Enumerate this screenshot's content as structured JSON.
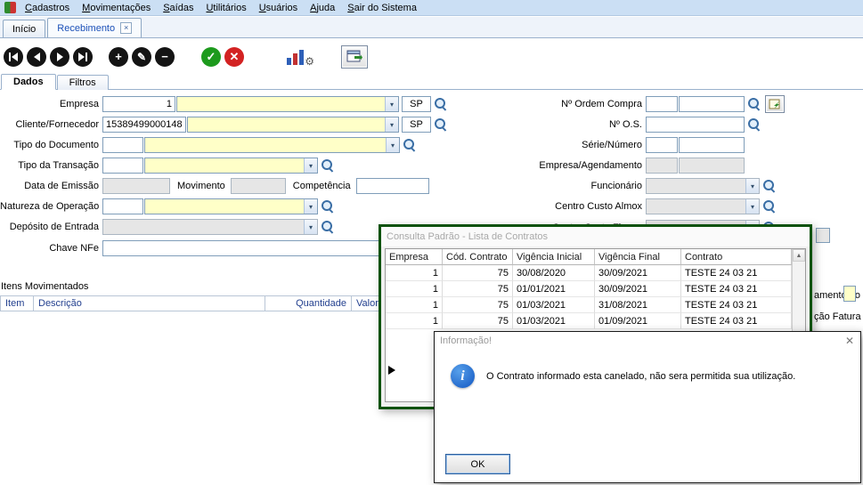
{
  "menu": {
    "items": [
      "Cadastros",
      "Movimentações",
      "Saídas",
      "Utilitários",
      "Usuários",
      "Ajuda",
      "Sair do Sistema"
    ]
  },
  "window_tabs": {
    "inicio": "Início",
    "recebimento": "Recebimento"
  },
  "view_tabs": {
    "dados": "Dados",
    "filtros": "Filtros"
  },
  "form": {
    "empresa": {
      "label": "Empresa",
      "code": "1",
      "name": "",
      "uf": "SP"
    },
    "cliente": {
      "label": "Cliente/Fornecedor",
      "code": "15389499000148",
      "name": "",
      "uf": "SP"
    },
    "tipo_documento": {
      "label": "Tipo do Documento",
      "code": "",
      "name": ""
    },
    "tipo_transacao": {
      "label": "Tipo da Transação",
      "code": "",
      "name": ""
    },
    "data_emissao": {
      "label": "Data de Emissão",
      "value": "",
      "movimento_label": "Movimento",
      "movimento": "",
      "competencia_label": "Competência",
      "competencia": ""
    },
    "natureza": {
      "label": "Natureza de Operação",
      "code": "",
      "name": ""
    },
    "deposito": {
      "label": "Depósito de Entrada",
      "value": ""
    },
    "chave_nfe": {
      "label": "Chave NFe",
      "value": ""
    },
    "ordem_compra": {
      "label": "Nº Ordem Compra",
      "v1": "",
      "v2": ""
    },
    "os": {
      "label": "Nº O.S.",
      "value": ""
    },
    "serie_numero": {
      "label": "Série/Número",
      "v1": "",
      "v2": ""
    },
    "empresa_agendamento": {
      "label": "Empresa/Agendamento",
      "v1": "",
      "v2": ""
    },
    "funcionario": {
      "label": "Funcionário",
      "value": ""
    },
    "centro_custo_almox": {
      "label": "Centro Custo Almox",
      "value": ""
    },
    "centro_custo_financ": {
      "label": "Centro Custo Financ",
      "value": ""
    }
  },
  "items_section": {
    "title": "Itens Movimentados",
    "columns": [
      "Item",
      "Descrição",
      "Quantidade",
      "Valor Unitário"
    ]
  },
  "clipped": {
    "pagamento": "amento do",
    "condicao": "ção Fatura"
  },
  "popup": {
    "title": "Consulta Padrão - Lista de Contratos",
    "columns": [
      "Empresa",
      "Cód. Contrato",
      "Vigência Inicial",
      "Vigência Final",
      "Contrato"
    ],
    "rows": [
      [
        "1",
        "75",
        "30/08/2020",
        "30/09/2021",
        "TESTE 24 03 21"
      ],
      [
        "1",
        "75",
        "01/01/2021",
        "30/09/2021",
        "TESTE 24 03 21"
      ],
      [
        "1",
        "75",
        "01/03/2021",
        "31/08/2021",
        "TESTE 24 03 21"
      ],
      [
        "1",
        "75",
        "01/03/2021",
        "01/09/2021",
        "TESTE 24 03 21"
      ]
    ]
  },
  "dialog": {
    "title": "Informação!",
    "message": "O Contrato informado esta canelado, não sera permitida sua utilização.",
    "ok_label": "OK"
  },
  "colors": {
    "field_required": "#ffffc8",
    "field_disabled": "#e6e6e6",
    "popup_border": "#0d520d",
    "active_tab_text": "#1b50b8",
    "menu_bg": "#cbdff4"
  }
}
